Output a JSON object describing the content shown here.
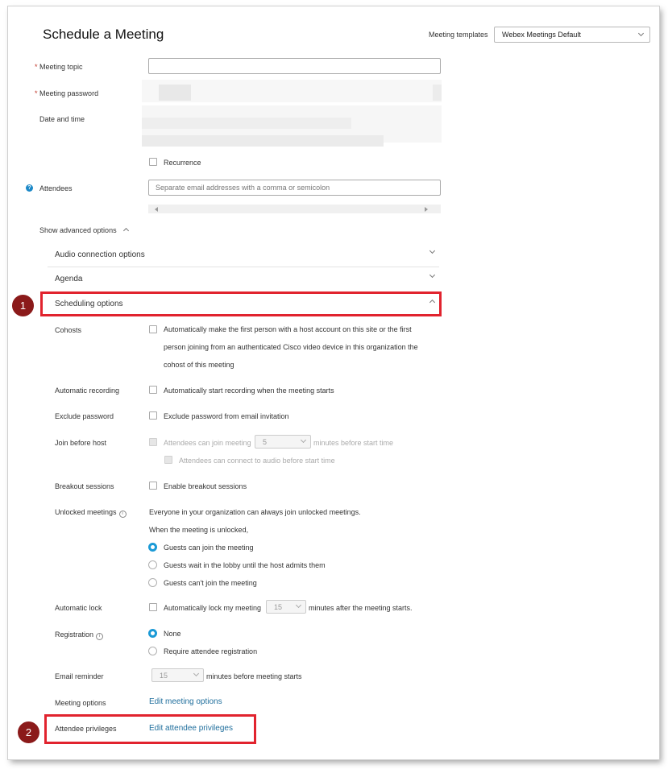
{
  "page": {
    "title": "Schedule a Meeting",
    "templates_label": "Meeting templates",
    "templates_value": "Webex Meetings Default"
  },
  "form": {
    "required_mark": "*",
    "topic_label": "Meeting topic",
    "password_label": "Meeting password",
    "datetime_label": "Date and time",
    "recurrence_label": "Recurrence",
    "attendees_label": "Attendees",
    "attendees_placeholder": "Separate email addresses with a comma or semicolon",
    "help_glyph": "?"
  },
  "advanced": {
    "toggle_label": "Show advanced options",
    "sections": {
      "audio": "Audio connection options",
      "agenda": "Agenda",
      "scheduling": "Scheduling options"
    }
  },
  "scheduling": {
    "cohosts_label": "Cohosts",
    "cohosts_text_1": "Automatically make the first person with a host account on this site or the first",
    "cohosts_text_2": "person joining from an authenticated Cisco video device in this organization the",
    "cohosts_text_3": "cohost of this meeting",
    "recording_label": "Automatic recording",
    "recording_text": "Automatically start recording when the meeting starts",
    "exclude_pw_label": "Exclude password",
    "exclude_pw_text": "Exclude password from email invitation",
    "jbh_label": "Join before host",
    "jbh_text": "Attendees can join meeting",
    "jbh_minutes": "5",
    "jbh_suffix": "minutes before start time",
    "jbh_audio_text": "Attendees can connect to audio before start time",
    "breakout_label": "Breakout sessions",
    "breakout_text": "Enable breakout sessions",
    "unlocked_label": "Unlocked meetings",
    "unlocked_text_1": "Everyone in your organization can always join unlocked meetings.",
    "unlocked_text_2": "When the meeting is unlocked,",
    "unlocked_options": [
      "Guests can join the meeting",
      "Guests wait in the lobby until the host admits them",
      "Guests can't join the meeting"
    ],
    "autolock_label": "Automatic lock",
    "autolock_text": "Automatically lock my meeting",
    "autolock_minutes": "15",
    "autolock_suffix": "minutes after the meeting starts.",
    "registration_label": "Registration",
    "registration_options": [
      "None",
      "Require attendee registration"
    ],
    "reminder_label": "Email reminder",
    "reminder_minutes": "15",
    "reminder_suffix": "minutes before meeting starts",
    "meeting_options_label": "Meeting options",
    "meeting_options_link": "Edit meeting options",
    "privileges_label": "Attendee privileges",
    "privileges_link": "Edit attendee privileges",
    "info_glyph": "i"
  },
  "annotations": {
    "badge_1": "1",
    "badge_2": "2",
    "highlight_color": "#e1232e",
    "badge_color": "#8b1a1a"
  },
  "colors": {
    "accent": "#1b9ad6",
    "link": "#1f6e9c"
  }
}
